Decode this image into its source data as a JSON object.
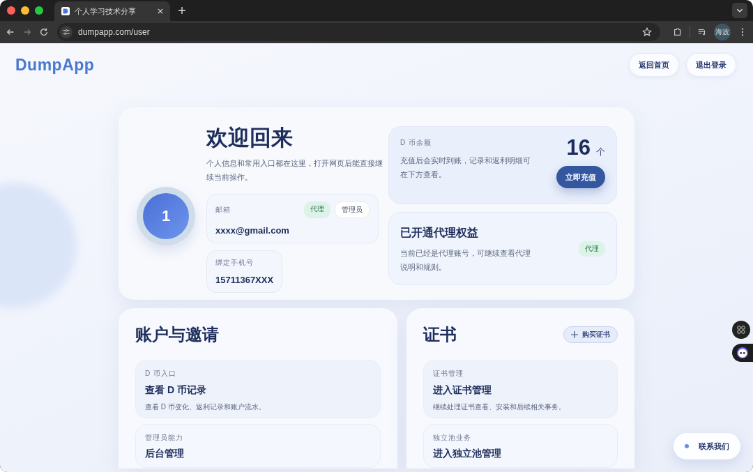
{
  "browser": {
    "tab": {
      "title": "个人学习技术分享"
    },
    "url": "dumpapp.com/user",
    "profile": "海波"
  },
  "header": {
    "logo": "DumpApp",
    "nav_buttons": [
      "返回首页",
      "退出登录"
    ]
  },
  "hero": {
    "avatar": "1",
    "title": "欢迎回来",
    "description": "个人信息和常用入口都在这里，打开网页后能直接继续当前操作。",
    "email": {
      "label": "邮箱",
      "value": "xxxx@gmail.com",
      "badges": [
        {
          "text": "代理",
          "kind": "agent"
        },
        {
          "text": "管理员",
          "kind": "admin"
        }
      ]
    },
    "phone": {
      "label": "绑定手机号",
      "value": "15711367XXX"
    },
    "balance": {
      "label": "D 币余额",
      "description": "充值后会实时到账，记录和返利明细可在下方查看。",
      "amount": "16",
      "unit": "个",
      "button": "立即充值"
    },
    "agent": {
      "title": "已开通代理权益",
      "description": "当前已经是代理账号，可继续查看代理说明和规则。",
      "badge": {
        "text": "代理",
        "kind": "agent"
      }
    }
  },
  "sections": [
    {
      "title": "账户与邀请",
      "items": [
        {
          "label": "D 币入口",
          "title": "查看 D 币记录",
          "description": "查看 D 币变化、返利记录和账户流水。"
        },
        {
          "label": "管理员能力",
          "title": "后台管理"
        }
      ]
    },
    {
      "title": "证书",
      "action": "购买证书",
      "items": [
        {
          "label": "证书管理",
          "title": "进入证书管理",
          "description": "继续处理证书查看、安装和后续相关事务。"
        },
        {
          "label": "独立池业务",
          "title": "进入独立池管理"
        }
      ]
    }
  ],
  "contact": {
    "label": "联系我们"
  }
}
